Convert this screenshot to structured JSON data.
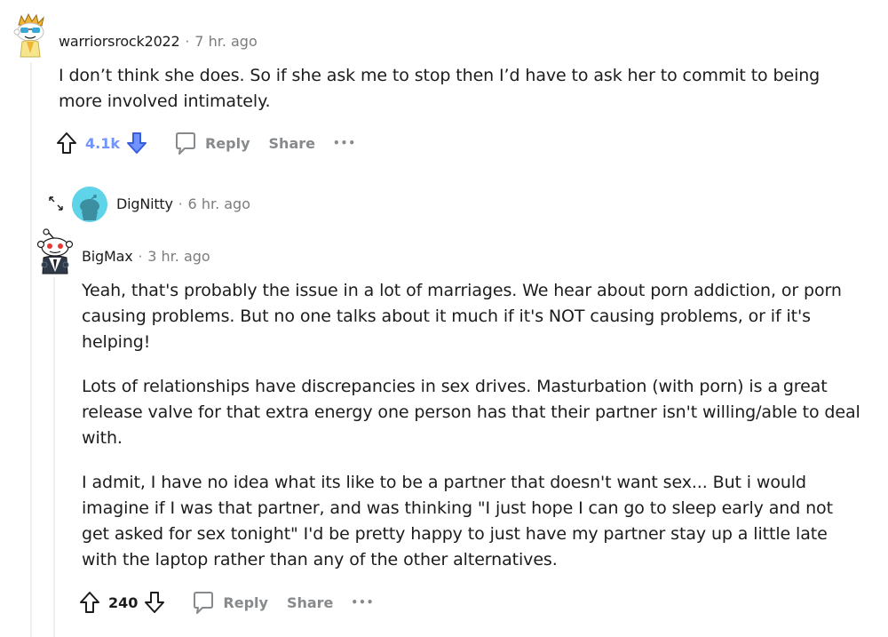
{
  "colors": {
    "upvote_active": "#7193ff",
    "downvote_active": "#7193ff",
    "icon_gray": "#1c1c1c",
    "action_gray": "#878a8c",
    "thread_line": "#edeff1"
  },
  "comments": [
    {
      "username": "warriorsrock2022",
      "separator": "·",
      "time": "7 hr. ago",
      "body": [
        "I don’t think she does. So if she ask me to stop then I’d have to ask her to commit to being more involved intimately."
      ],
      "votes": "4.1k",
      "reply_label": "Reply",
      "share_label": "Share",
      "more_label": "•••"
    },
    {
      "username": "DigNitty",
      "separator": "·",
      "time": "6 hr. ago",
      "collapsed": true
    },
    {
      "username": "BigMax",
      "separator": "·",
      "time": "3 hr. ago",
      "body": [
        "Yeah, that's probably the issue in a lot of marriages. We hear about porn addiction, or porn causing problems. But no one talks about it much if it's NOT causing problems, or if it's helping!",
        "Lots of relationships have discrepancies in sex drives. Masturbation (with porn) is a great release valve for that extra energy one person has that their partner isn't willing/able to deal with.",
        "I admit, I have no idea what its like to be a partner that doesn't want sex... But i would imagine if I was that partner, and was thinking \"I just hope I can go to sleep early and not get asked for sex tonight\" I'd be pretty happy to just have my partner stay up a little late with the laptop rather than any of the other alternatives."
      ],
      "votes": "240",
      "reply_label": "Reply",
      "share_label": "Share",
      "more_label": "•••"
    }
  ]
}
